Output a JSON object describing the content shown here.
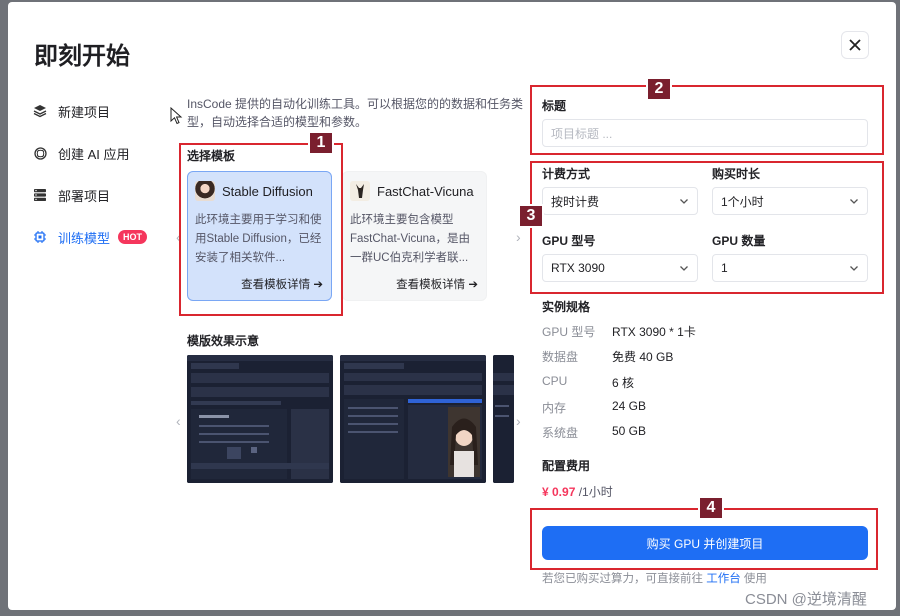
{
  "modal": {
    "title": "即刻开始"
  },
  "nav": [
    {
      "label": "新建项目"
    },
    {
      "label": "创建 AI 应用"
    },
    {
      "label": "部署项目"
    },
    {
      "label": "训练模型",
      "badge": "HOT"
    }
  ],
  "intro": "InsCode 提供的自动化训练工具。可以根据您的的数据和任务类型，自动选择合适的模型和参数。",
  "templates": {
    "label": "选择模板",
    "items": [
      {
        "name": "Stable Diffusion",
        "desc": "此环境主要用于学习和使用Stable Diffusion，已经安装了相关软件...",
        "more": "查看模板详情 ➔"
      },
      {
        "name": "FastChat-Vicuna",
        "desc": "此环境主要包含模型FastChat-Vicuna，是由一群UC伯克利学者联...",
        "more": "查看模板详情 ➔"
      }
    ]
  },
  "preview": {
    "label": "模版效果示意"
  },
  "form": {
    "title_label": "标题",
    "title_placeholder": "项目标题 ...",
    "billing_label": "计费方式",
    "billing_value": "按时计费",
    "duration_label": "购买时长",
    "duration_value": "1个小时",
    "gpu_type_label": "GPU 型号",
    "gpu_type_value": "RTX 3090",
    "gpu_count_label": "GPU 数量",
    "gpu_count_value": "1"
  },
  "spec": {
    "label": "实例规格",
    "rows": [
      {
        "k": "GPU 型号",
        "v": "RTX 3090 * 1卡"
      },
      {
        "k": "数据盘",
        "v": "免费 40 GB"
      },
      {
        "k": "CPU",
        "v": "6 核"
      },
      {
        "k": "内存",
        "v": "24 GB"
      },
      {
        "k": "系统盘",
        "v": "50 GB"
      }
    ]
  },
  "cost": {
    "label": "配置费用",
    "amount": "¥ 0.97",
    "unit": " /1小时"
  },
  "buy_button": "购买 GPU 并创建项目",
  "footnote": {
    "pre": "若您已购买过算力，可直接前往 ",
    "link": "工作台",
    "post": " 使用"
  },
  "annotations": [
    "1",
    "2",
    "3",
    "4"
  ],
  "watermark": "CSDN @逆境清醒",
  "colors": {
    "accent": "#1e6ef4",
    "hot": "#f5365c",
    "annotation_border": "#d9262f",
    "annotation_badge": "#7a1f2e"
  }
}
